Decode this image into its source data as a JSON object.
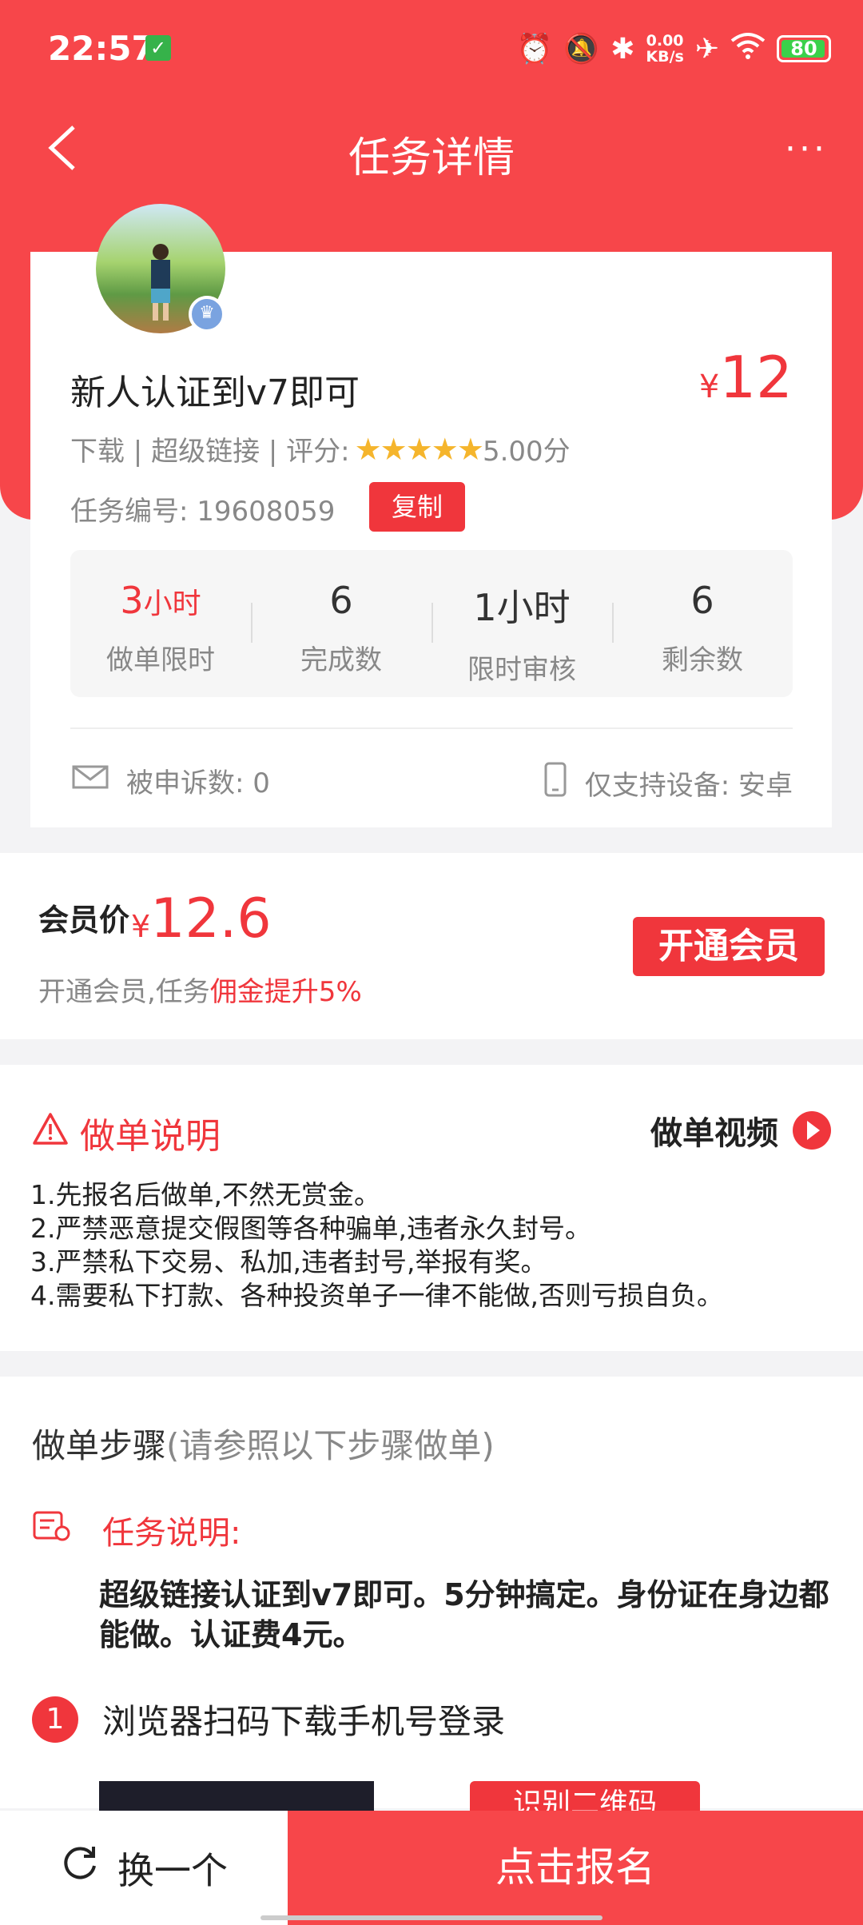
{
  "status_bar": {
    "time": "22:57",
    "kbs_top": "0.00",
    "kbs_bottom": "KB/s",
    "battery": "80"
  },
  "nav": {
    "title": "任务详情",
    "more": "···"
  },
  "task": {
    "title": "新人认证到v7即可",
    "price_symbol": "¥",
    "price": "12",
    "tags": "下载 | 超级链接 | 评分:",
    "stars": "★★★★★",
    "rating": "5.00分",
    "task_no_label": "任务编号:",
    "task_no": "19608059",
    "copy_label": "复制"
  },
  "stats": [
    {
      "value": "3",
      "unit": "小时",
      "label": "做单限时"
    },
    {
      "value": "6",
      "label": "完成数"
    },
    {
      "value": "1小时",
      "label": "限时审核"
    },
    {
      "value": "6",
      "label": "剩余数"
    }
  ],
  "complaint": "被申诉数: 0",
  "device": "仅支持设备: 安卓",
  "member": {
    "label": "会员价",
    "price_symbol": "¥",
    "price": "12.6",
    "desc": "开通会员,任务",
    "desc_highlight": "佣金提升5%",
    "button": "开通会员"
  },
  "rules": {
    "title": "做单说明",
    "video_label": "做单视频",
    "items": [
      "1.先报名后做单,不然无赏金。",
      "2.严禁恶意提交假图等各种骗单,违者永久封号。",
      "3.严禁私下交易、私加,违者封号,举报有奖。",
      "4.需要私下打款、各种投资单子一律不能做,否则亏损自负。"
    ]
  },
  "steps": {
    "title": "做单步骤",
    "subtitle": "(请参照以下步骤做单)",
    "desc_label": "任务说明:",
    "desc": "超级链接认证到v7即可。5分钟搞定。身份证在身边都能做。认证费4元。",
    "step1_num": "1",
    "step1": "浏览器扫码下载手机号登录",
    "qr_button": "识别二维码"
  },
  "bottom": {
    "refresh": "换一个",
    "signup": "点击报名"
  }
}
